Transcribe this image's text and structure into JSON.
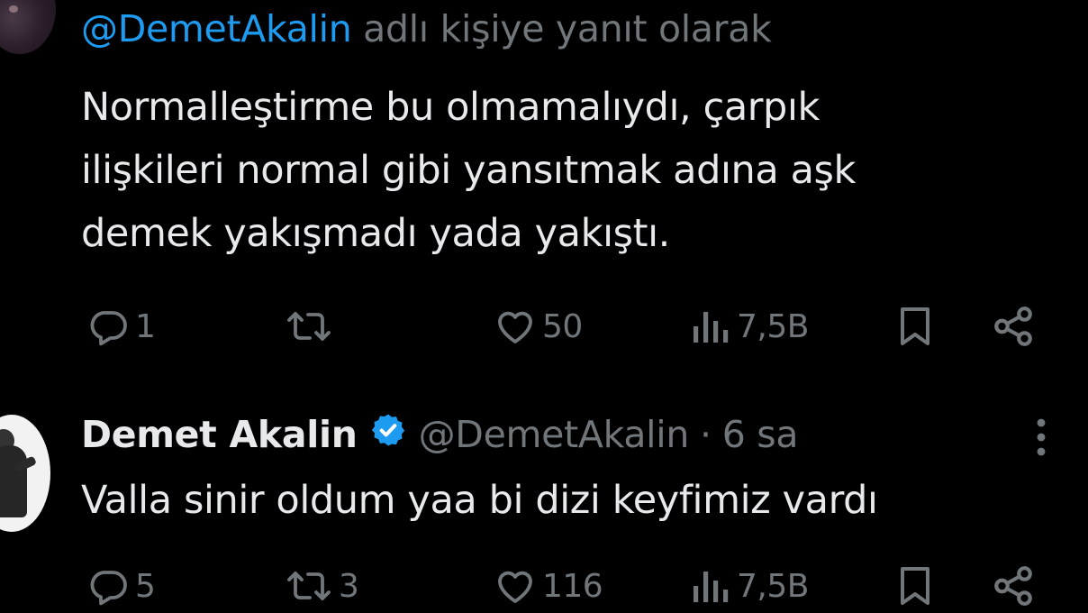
{
  "tweet1": {
    "reply_to_handle": "@DemetAkalin",
    "reply_suffix": " adlı kişiye yanıt olarak",
    "text_lines": [
      "Normalleştirme bu olmamalıydı, çarpık",
      "ilişkileri normal gibi yansıtmak adına aşk",
      "demek yakışmadı yada yakıştı."
    ],
    "actions": {
      "reply_count": "1",
      "retweet_count": "",
      "like_count": "50",
      "views_count": "7,5B"
    }
  },
  "tweet2": {
    "display_name": "Demet Akalin",
    "handle": "@DemetAkalin",
    "separator": "·",
    "time": "6 sa",
    "text": "Valla sinir oldum yaa bi dizi keyfimiz vardı",
    "actions": {
      "reply_count": "5",
      "retweet_count": "3",
      "like_count": "116",
      "views_count": "7,5B"
    }
  },
  "colors": {
    "background": "#000000",
    "text_primary": "#e7e9ea",
    "text_secondary": "#71767b",
    "link": "#1d9bf0",
    "verified_badge": "#1d9bf0"
  },
  "icons": {
    "reply": "reply-icon",
    "retweet": "retweet-icon",
    "like": "heart-icon",
    "views": "views-icon",
    "bookmark": "bookmark-icon",
    "share": "share-icon",
    "verified": "verified-badge-icon",
    "more": "more-vertical-icon"
  }
}
